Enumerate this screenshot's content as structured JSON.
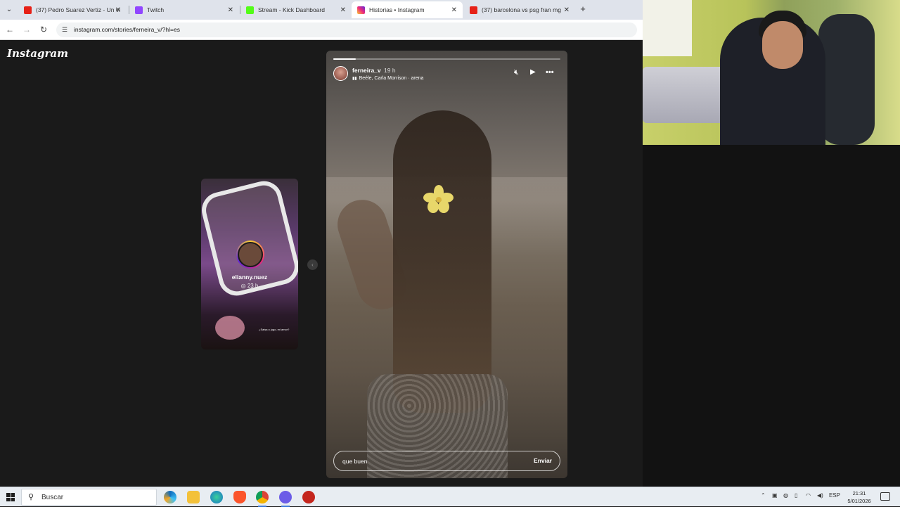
{
  "browser": {
    "tabs": [
      {
        "title": "(37) Pedro Suarez Vertiz - Un vi",
        "favicon_color": "#e62117",
        "active": false
      },
      {
        "title": "Twitch",
        "favicon_color": "#9146ff",
        "active": false
      },
      {
        "title": "Stream - Kick Dashboard",
        "favicon_color": "#53fc18",
        "active": false
      },
      {
        "title": "Historias • Instagram",
        "favicon_color": "#d6249f",
        "active": true
      },
      {
        "title": "(37) barcelona vs psg fran mg",
        "favicon_color": "#e62117",
        "active": false
      }
    ],
    "url": "instagram.com/stories/ferneira_v/?hl=es"
  },
  "instagram": {
    "logo": "Instagram",
    "side_story": {
      "username": "elianny.nuez",
      "time": "23 h",
      "caption": "¿Salsa o jugo, mi amor?"
    },
    "story": {
      "username": "ferneira_v",
      "time": "19 h",
      "music": "Beéle, Carla Morrison · arena",
      "progress": 0.1
    },
    "reply": {
      "value": "que buen ",
      "send_label": "Enviar"
    }
  },
  "taskbar": {
    "search_label": "Buscar",
    "language": "ESP",
    "time": "21:31",
    "date": "5/01/2026"
  }
}
